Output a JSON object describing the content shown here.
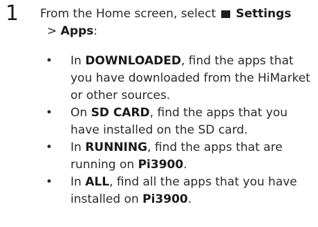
{
  "step": {
    "number": "1",
    "intro_prefix": "From the Home screen, select ",
    "icon": "settings-icon",
    "settings_label": "Settings",
    "sub_prefix": "> ",
    "apps_label": "Apps",
    "apps_suffix": ":"
  },
  "bullets": [
    {
      "symbol": "•",
      "prefix": "In ",
      "keyword": "DOWNLOADED",
      "text": ", find the apps that you have downloaded from the HiMarket or other sources.",
      "device": "",
      "end": ""
    },
    {
      "symbol": "•",
      "prefix": "On ",
      "keyword": "SD CARD",
      "text": ", find the apps that you have installed on the SD card.",
      "device": "",
      "end": ""
    },
    {
      "symbol": "•",
      "prefix": "In ",
      "keyword": "RUNNING",
      "text": ", find the apps that are running on ",
      "device": "Pi3900",
      "end": "."
    },
    {
      "symbol": "•",
      "prefix": "In ",
      "keyword": "ALL",
      "text": ", find all the apps that you have installed on ",
      "device": "Pi3900",
      "end": "."
    }
  ]
}
